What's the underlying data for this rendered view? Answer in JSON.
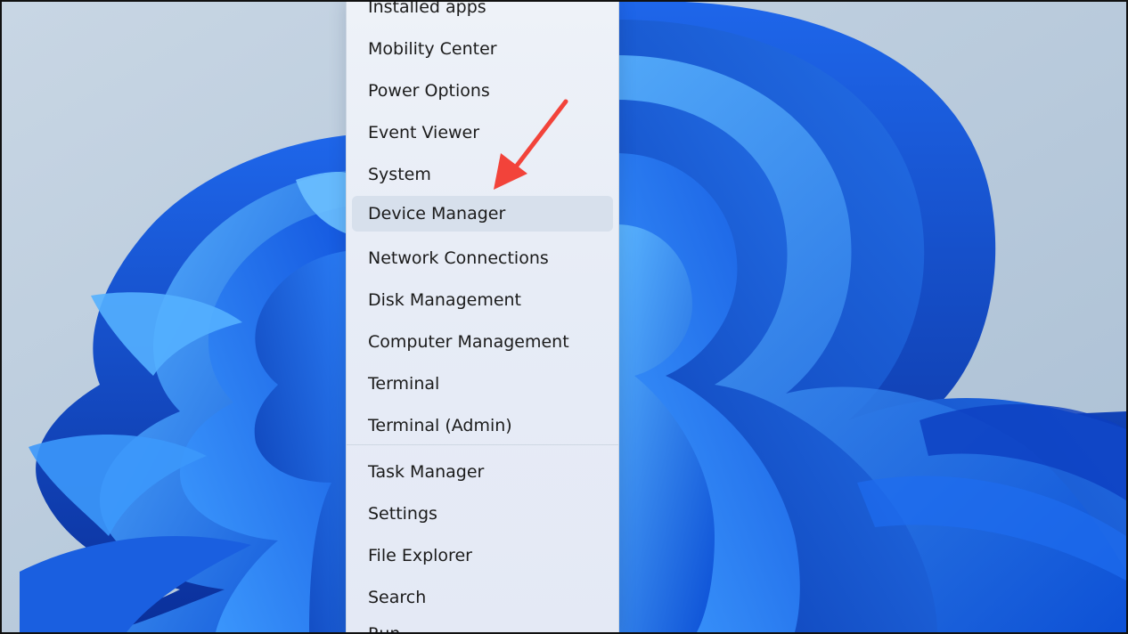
{
  "context_menu": {
    "groups": [
      {
        "items": [
          {
            "label": "Installed apps"
          },
          {
            "label": "Mobility Center"
          },
          {
            "label": "Power Options"
          },
          {
            "label": "Event Viewer"
          },
          {
            "label": "System"
          },
          {
            "label": "Device Manager",
            "highlighted": true
          },
          {
            "label": "Network Connections"
          },
          {
            "label": "Disk Management"
          },
          {
            "label": "Computer Management"
          },
          {
            "label": "Terminal"
          },
          {
            "label": "Terminal (Admin)"
          }
        ]
      },
      {
        "items": [
          {
            "label": "Task Manager"
          },
          {
            "label": "Settings"
          },
          {
            "label": "File Explorer"
          },
          {
            "label": "Search"
          },
          {
            "label": "Run"
          }
        ]
      }
    ]
  },
  "annotation": {
    "type": "arrow",
    "color": "#f2433a",
    "points_to": "Device Manager"
  },
  "colors": {
    "wallpaper_bg": "#b9cbdc",
    "bloom_blue": "#1a5fe0",
    "bloom_light": "#4aa3ff",
    "highlight": "#d7e0ec"
  }
}
